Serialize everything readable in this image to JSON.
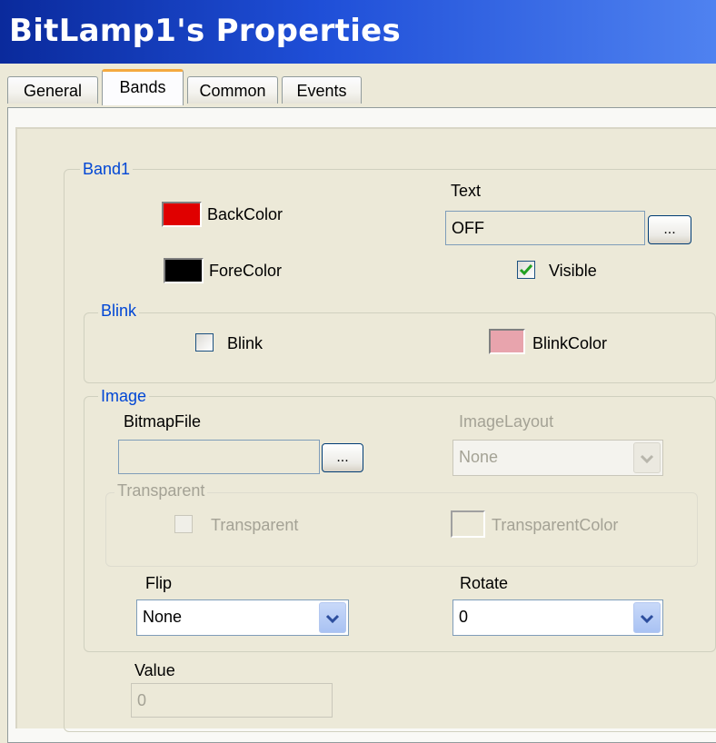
{
  "window": {
    "title": "BitLamp1's Properties"
  },
  "tabs": [
    {
      "label": "General"
    },
    {
      "label": "Bands",
      "active": true
    },
    {
      "label": "Common"
    },
    {
      "label": "Events"
    }
  ],
  "band1": {
    "legend": "Band1",
    "backcolor": {
      "label": "BackColor",
      "color": "#e00000"
    },
    "forecolor": {
      "label": "ForeColor",
      "color": "#000000"
    },
    "text": {
      "label": "Text",
      "value": "OFF",
      "browse_label": "..."
    },
    "visible": {
      "label": "Visible",
      "checked": true
    },
    "blink": {
      "legend": "Blink",
      "checkbox_label": "Blink",
      "checked": false,
      "blinkcolor": {
        "label": "BlinkColor",
        "color": "#e8a4ad"
      }
    },
    "image": {
      "legend": "Image",
      "bitmapfile": {
        "label": "BitmapFile",
        "value": "",
        "browse_label": "..."
      },
      "imagelayout": {
        "label": "ImageLayout",
        "value": "None"
      },
      "transparent_group": {
        "legend": "Transparent",
        "checkbox_label": "Transparent",
        "color_label": "TransparentColor",
        "color": "#ece9d8"
      },
      "flip": {
        "label": "Flip",
        "value": "None"
      },
      "rotate": {
        "label": "Rotate",
        "value": "0"
      }
    },
    "value": {
      "label": "Value",
      "value": "0"
    }
  },
  "colors": {
    "title_start": "#0a2a9c",
    "title_end": "#4f82f0",
    "group_label": "#0046d5",
    "active_tab_accent": "#f4a93f"
  }
}
